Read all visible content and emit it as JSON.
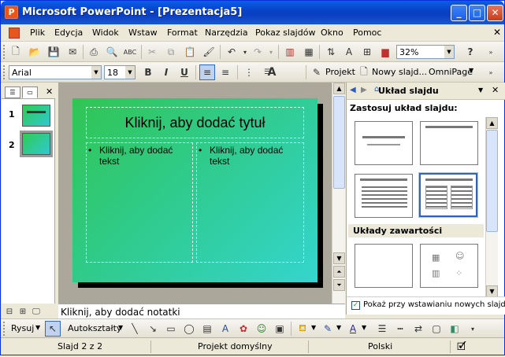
{
  "window": {
    "title": "Microsoft PowerPoint - [Prezentacja5]"
  },
  "menu": [
    "Plik",
    "Edycja",
    "Widok",
    "Wstaw",
    "Format",
    "Narzędzia",
    "Pokaz slajdów",
    "Okno",
    "Pomoc"
  ],
  "toolbar": {
    "zoom": "32%"
  },
  "format": {
    "font": "Arial",
    "size": "18",
    "bold": "B",
    "italic": "I",
    "underline": "U",
    "project_label": "Projekt",
    "new_slide_label": "Nowy slajd...",
    "omnipage_label": "OmniPage"
  },
  "slides_pane": {
    "slide_numbers": [
      "1",
      "2"
    ]
  },
  "slide": {
    "title_placeholder": "Kliknij, aby dodać tytuł",
    "left_text": "Kliknij, aby dodać tekst",
    "right_text": "Kliknij, aby dodać tekst",
    "bullet": "•"
  },
  "notes": {
    "placeholder": "Kliknij, aby dodać notatki"
  },
  "task_pane": {
    "title": "Układ slajdu",
    "section_apply": "Zastosuj układ slajdu:",
    "section_content": "Układy zawartości",
    "checkbox_label": "Pokaż przy wstawianiu nowych slajdów",
    "checkbox_checked": true
  },
  "drawing": {
    "draw_label": "Rysuj",
    "autoshapes_label": "Autokształty"
  },
  "status": {
    "slide": "Slajd 2 z 2",
    "design": "Projekt domyślny",
    "language": "Polski"
  },
  "colors": {
    "slide_green": "#31c553",
    "slide_teal": "#34d5cf",
    "title_bar": "#0a5fe8",
    "selection": "#3163b7"
  }
}
